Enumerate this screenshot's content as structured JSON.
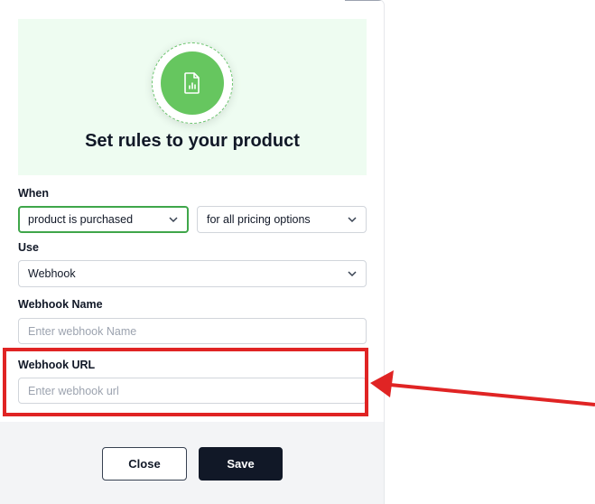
{
  "hero": {
    "title": "Set rules to your product",
    "icon": "document-chart-icon"
  },
  "when": {
    "label": "When",
    "trigger_value": "product is purchased",
    "pricing_value": "for all pricing options"
  },
  "use": {
    "label": "Use",
    "value": "Webhook"
  },
  "webhook_name": {
    "label": "Webhook Name",
    "placeholder": "Enter webhook Name"
  },
  "webhook_url": {
    "label": "Webhook URL",
    "placeholder": "Enter webhook url"
  },
  "footer": {
    "close_label": "Close",
    "save_label": "Save"
  },
  "colors": {
    "accent": "#66c65f",
    "highlight": "#e02424",
    "primary_button": "#111827"
  }
}
